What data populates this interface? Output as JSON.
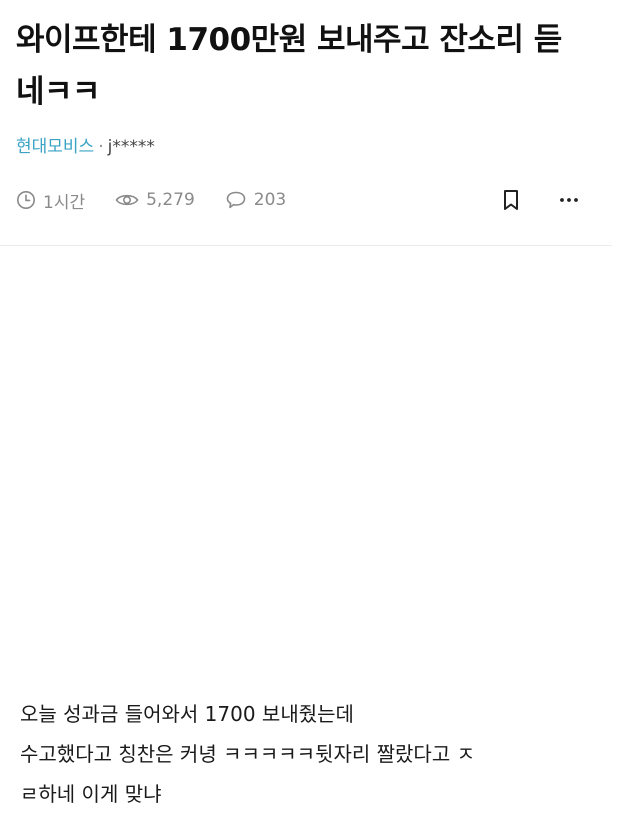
{
  "post": {
    "title_line1": "와이프한테 1700만원 보내주고 잔소리 듣",
    "title_line2": "네ㅋㅋ",
    "board": "현대모비스",
    "separator": "·",
    "author": "j*****"
  },
  "stats": {
    "time": "1시간",
    "views": "5,279",
    "comments": "203"
  },
  "icons": {
    "time": "clock-icon",
    "views": "eye-icon",
    "comments": "comment-icon",
    "bookmark": "bookmark-icon",
    "more": "more-icon"
  },
  "body": {
    "line1": "오늘 성과금 들어와서 1700 보내줬는데",
    "line2": "수고했다고 칭찬은 커녕 ㅋㅋㅋㅋㅋ뒷자리 짤랐다고 ㅈ",
    "line3": "ㄹ하네 이게 맞냐"
  },
  "colors": {
    "board_link": "#3aa3c4",
    "meta_gray": "#8a8a8a",
    "divider": "#ececec"
  }
}
